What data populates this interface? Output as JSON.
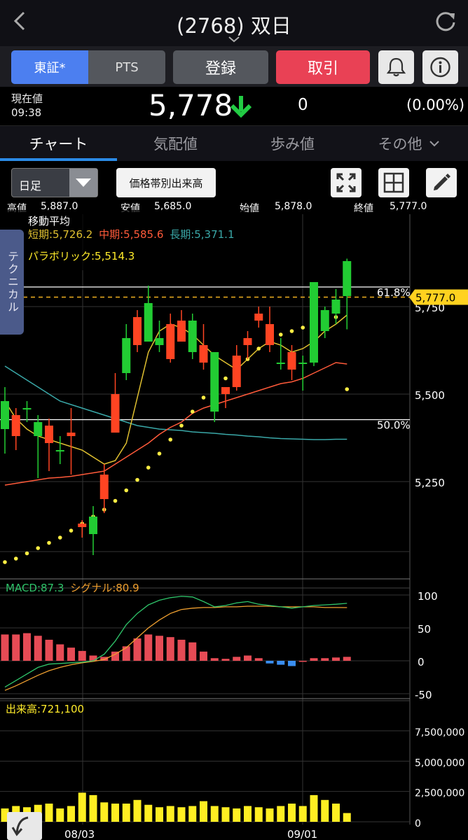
{
  "header": {
    "title": "(2768) 双日"
  },
  "buttons": {
    "market_tse": "東証*",
    "market_pts": "PTS",
    "register": "登録",
    "trade": "取引"
  },
  "price": {
    "label": "現在値",
    "time": "09:38",
    "value": "5,778",
    "change": "0",
    "change_pct": "(0.00%)"
  },
  "tabs": [
    "チャート",
    "気配値",
    "歩み値",
    "その他"
  ],
  "controls": {
    "period": "日足",
    "volume_by_price": "価格帯別出来高"
  },
  "ohlc": {
    "high_label": "高値",
    "high": "5,887.0",
    "low_label": "安値",
    "low": "5,685.0",
    "open_label": "始値",
    "open": "5,878.0",
    "close_label": "終値",
    "close": "5,777.0"
  },
  "indicators": {
    "ma_title": "移動平均",
    "ma_short": "短期:5,726.2",
    "ma_mid": "中期:5,585.6",
    "ma_long": "長期:5,371.1",
    "parabolic": "パラボリック:5,514.3",
    "technical_tab": "テクニカル",
    "macd_label": "MACD:87.3",
    "signal_label": "シグナル:80.9",
    "volume_label": "出来高:721,100"
  },
  "colors": {
    "up": "#22cc33",
    "down": "#ff4422",
    "ma_short": "#e0c030",
    "ma_mid": "#ff5a3a",
    "ma_long": "#3aa8a8",
    "parabolic": "#ffee44",
    "macd": "#2fc46a",
    "signal": "#f0a030",
    "hist_pos": "#e64b55",
    "hist_neg": "#3a8ef0",
    "volume": "#ffee22",
    "accent": "#2b8be6"
  },
  "chart_data": {
    "type": "candlestick",
    "price_axis": {
      "ticks": [
        5250,
        5500,
        5750
      ],
      "ylim": [
        5070,
        5880
      ]
    },
    "current_price_tag": "5,777.0",
    "fib_levels": [
      {
        "label": "61.8%",
        "price": 5806
      },
      {
        "label": "50.0%",
        "price": 5427
      }
    ],
    "x_labels": [
      "08/03",
      "09/01"
    ],
    "candles": [
      {
        "o": 5400,
        "c": 5480,
        "h": 5520,
        "l": 5330
      },
      {
        "o": 5440,
        "c": 5380,
        "h": 5460,
        "l": 5340
      },
      {
        "o": 5460,
        "c": 5460,
        "h": 5480,
        "l": 5420
      },
      {
        "o": 5380,
        "c": 5420,
        "h": 5440,
        "l": 5260
      },
      {
        "o": 5410,
        "c": 5360,
        "h": 5430,
        "l": 5280
      },
      {
        "o": 5340,
        "c": 5340,
        "h": 5380,
        "l": 5300
      },
      {
        "o": 5390,
        "c": 5380,
        "h": 5460,
        "l": 5270
      },
      {
        "o": 5130,
        "c": 5120,
        "h": 5140,
        "l": 5090
      },
      {
        "o": 5100,
        "c": 5150,
        "h": 5180,
        "l": 5040
      },
      {
        "o": 5270,
        "c": 5200,
        "h": 5300,
        "l": 5160
      },
      {
        "o": 5500,
        "c": 5390,
        "h": 5560,
        "l": 5390
      },
      {
        "o": 5560,
        "c": 5660,
        "h": 5700,
        "l": 5540
      },
      {
        "o": 5720,
        "c": 5640,
        "h": 5740,
        "l": 5620
      },
      {
        "o": 5650,
        "c": 5760,
        "h": 5810,
        "l": 5650
      },
      {
        "o": 5640,
        "c": 5660,
        "h": 5710,
        "l": 5620
      },
      {
        "o": 5700,
        "c": 5600,
        "h": 5730,
        "l": 5590
      },
      {
        "o": 5710,
        "c": 5650,
        "h": 5740,
        "l": 5650
      },
      {
        "o": 5620,
        "c": 5710,
        "h": 5730,
        "l": 5600
      },
      {
        "o": 5640,
        "c": 5590,
        "h": 5700,
        "l": 5570
      },
      {
        "o": 5450,
        "c": 5620,
        "h": 5620,
        "l": 5420
      },
      {
        "o": 5520,
        "c": 5500,
        "h": 5520,
        "l": 5460
      },
      {
        "o": 5610,
        "c": 5520,
        "h": 5640,
        "l": 5510
      },
      {
        "o": 5660,
        "c": 5640,
        "h": 5680,
        "l": 5600
      },
      {
        "o": 5730,
        "c": 5710,
        "h": 5750,
        "l": 5690
      },
      {
        "o": 5700,
        "c": 5640,
        "h": 5750,
        "l": 5620
      },
      {
        "o": 5590,
        "c": 5590,
        "h": 5660,
        "l": 5570
      },
      {
        "o": 5620,
        "c": 5570,
        "h": 5640,
        "l": 5540
      },
      {
        "o": 5590,
        "c": 5590,
        "h": 5610,
        "l": 5510
      },
      {
        "o": 5590,
        "c": 5820,
        "h": 5820,
        "l": 5580
      },
      {
        "o": 5680,
        "c": 5740,
        "h": 5750,
        "l": 5660
      },
      {
        "o": 5730,
        "c": 5770,
        "h": 5800,
        "l": 5700
      },
      {
        "o": 5780,
        "c": 5880,
        "h": 5887,
        "l": 5685
      }
    ],
    "ma_short": [
      5480,
      5430,
      5400,
      5380,
      5370,
      5360,
      5350,
      5340,
      5320,
      5300,
      5310,
      5360,
      5490,
      5620,
      5680,
      5700,
      5690,
      5670,
      5640,
      5610,
      5590,
      5570,
      5600,
      5630,
      5650,
      5640,
      5620,
      5630,
      5650,
      5680,
      5700,
      5726
    ],
    "ma_mid": [
      5240,
      5245,
      5250,
      5255,
      5260,
      5262,
      5265,
      5270,
      5275,
      5280,
      5300,
      5320,
      5340,
      5360,
      5385,
      5405,
      5420,
      5445,
      5460,
      5470,
      5480,
      5490,
      5500,
      5510,
      5520,
      5530,
      5535,
      5545,
      5560,
      5575,
      5590,
      5586
    ],
    "ma_long": [
      5580,
      5560,
      5540,
      5520,
      5500,
      5480,
      5470,
      5460,
      5450,
      5440,
      5430,
      5420,
      5410,
      5405,
      5400,
      5398,
      5396,
      5392,
      5390,
      5388,
      5385,
      5383,
      5380,
      5378,
      5375,
      5373,
      5372,
      5371,
      5370,
      5370,
      5371,
      5371
    ],
    "parabolic": [
      5020,
      5030,
      5045,
      5060,
      5075,
      5090,
      5110,
      5130,
      5150,
      5170,
      5195,
      5225,
      5255,
      5290,
      5330,
      5370,
      5410,
      5450,
      5490,
      5520,
      5545,
      5570,
      5600,
      5630,
      5660,
      5670,
      5680,
      5690,
      5700,
      5710,
      5720,
      5514
    ],
    "macd_axis": {
      "ticks": [
        100,
        50,
        0,
        -50
      ],
      "ylim": [
        -60,
        110
      ]
    },
    "macd": [
      -40,
      -30,
      -20,
      -10,
      -5,
      -4,
      -3,
      -2,
      0,
      10,
      30,
      55,
      72,
      85,
      92,
      96,
      98,
      97,
      90,
      82,
      84,
      88,
      90,
      86,
      84,
      82,
      80,
      82,
      84,
      85,
      86,
      87.3
    ],
    "signal": [
      -45,
      -38,
      -30,
      -22,
      -15,
      -10,
      -6,
      -3,
      -1,
      2,
      10,
      20,
      35,
      50,
      62,
      72,
      78,
      80,
      81,
      81,
      82,
      82,
      83,
      83,
      83,
      82,
      82,
      82,
      82,
      81,
      81,
      80.9
    ],
    "hist": [
      40,
      40,
      42,
      38,
      32,
      25,
      20,
      15,
      8,
      6,
      14,
      22,
      34,
      40,
      38,
      36,
      32,
      28,
      14,
      4,
      3,
      6,
      8,
      4,
      -4,
      -6,
      -8,
      0,
      4,
      4,
      5,
      6
    ],
    "volume_axis": {
      "ticks": [
        "7,500,000",
        "5,000,000",
        "2,500,000",
        "0"
      ],
      "ylim": [
        0,
        8000000
      ]
    },
    "volume": [
      1100000,
      1300000,
      1200000,
      1400000,
      1500000,
      1100000,
      1300000,
      2400000,
      2200000,
      1600000,
      1500000,
      1500000,
      1800000,
      1400000,
      1200000,
      1300000,
      1200000,
      1300000,
      1700000,
      1300000,
      1200000,
      1100000,
      1300000,
      1200000,
      1100000,
      1300000,
      1500000,
      1300000,
      2200000,
      1800000,
      1500000,
      721100
    ]
  }
}
